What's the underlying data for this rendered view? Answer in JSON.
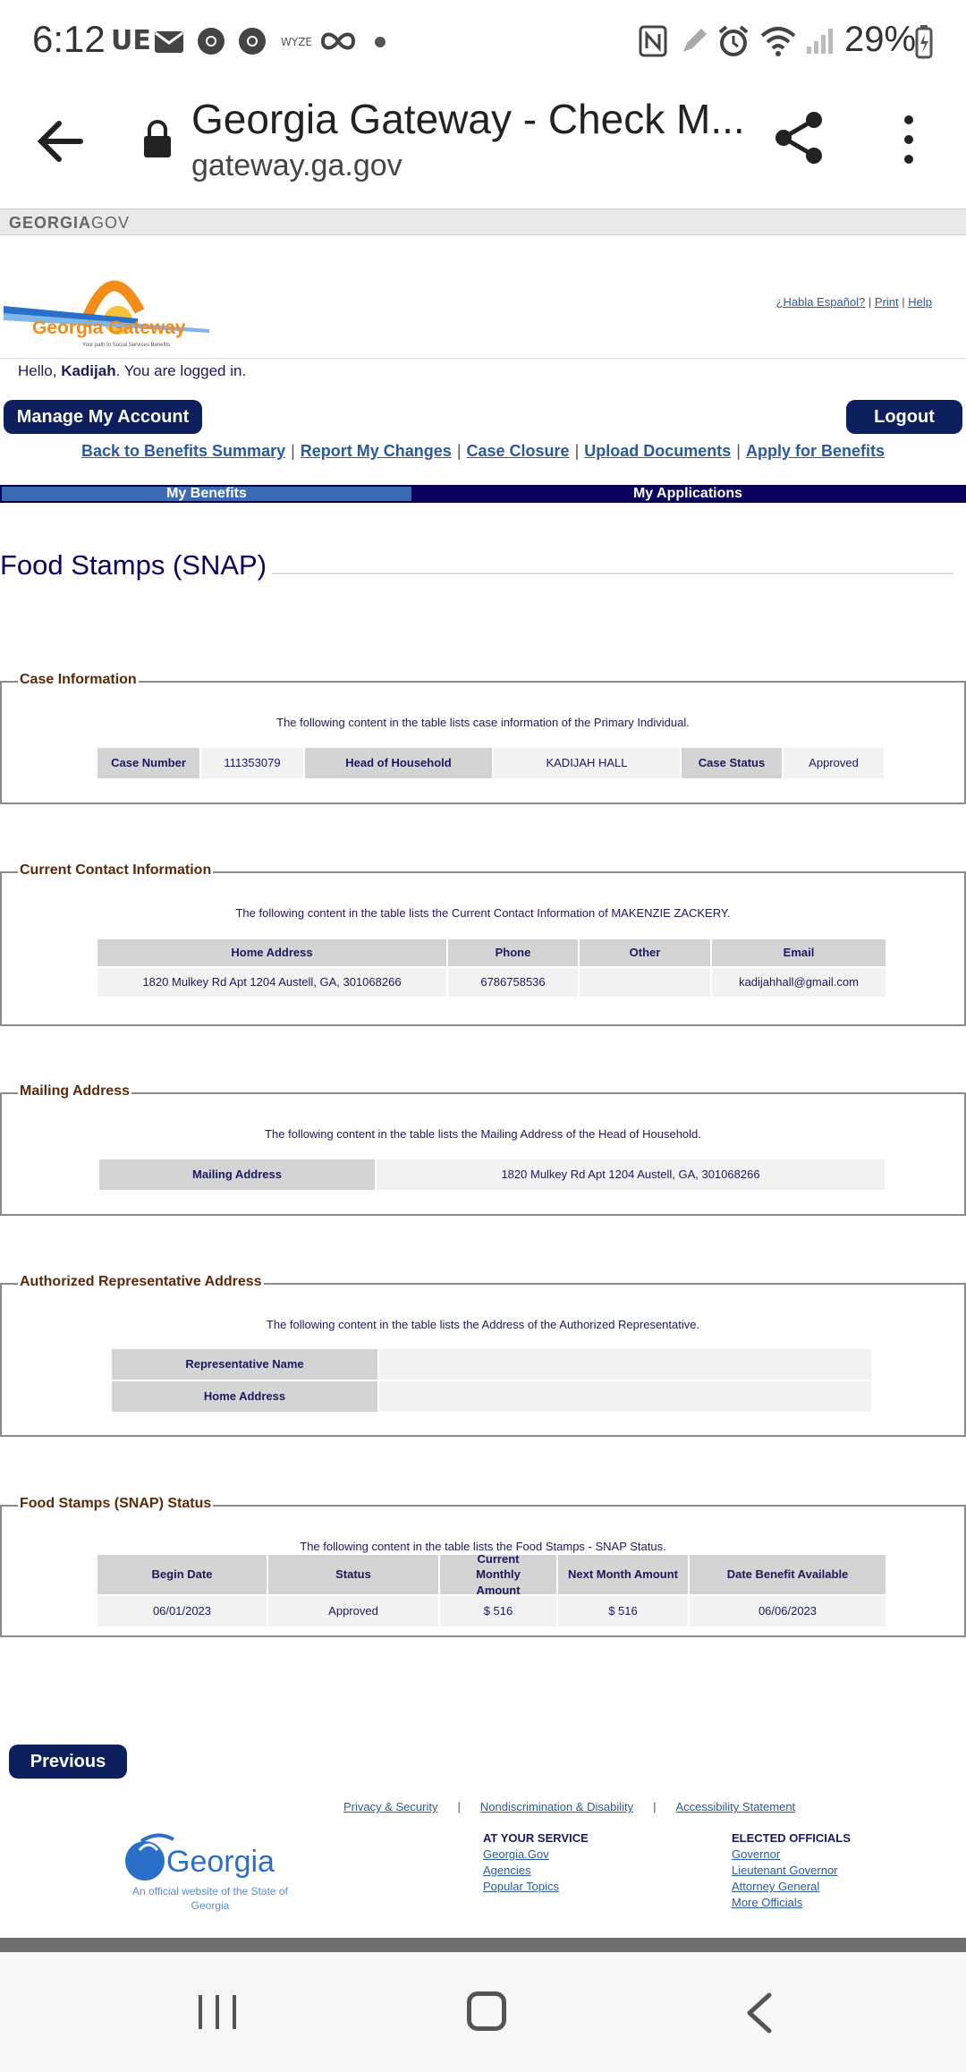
{
  "status_bar": {
    "time": "6:12",
    "left_icons": [
      "UE",
      "mail-icon",
      "chrome-icon",
      "chrome-icon",
      "wyze-icon",
      "infinity-icon",
      "dot-icon"
    ],
    "wyze_label": "WYZE",
    "ue_label": "UE",
    "battery": "29%"
  },
  "browser": {
    "title": "Georgia Gateway - Check M...",
    "url": "gateway.ga.gov"
  },
  "gagov": {
    "label_bold": "GEORGIA",
    "label_rest": "GOV"
  },
  "header": {
    "logo_title": "Georgia Gateway",
    "logo_tagline": "Your path to Social Services Benefits",
    "top_links": [
      "¿Habla Español?",
      "Print",
      "Help"
    ],
    "hello_prefix": "Hello, ",
    "user_name": "Kadijah",
    "hello_suffix": ". You are logged in."
  },
  "buttons": {
    "manage": "Manage My Account",
    "logout": "Logout",
    "previous": "Previous"
  },
  "nav_links": [
    "Back to Benefits Summary",
    "Report My Changes",
    "Case Closure",
    "Upload Documents",
    "Apply for Benefits"
  ],
  "tabs": {
    "benefits": "My Benefits",
    "applications": "My Applications"
  },
  "section_title": "Food Stamps (SNAP)",
  "case_info": {
    "legend": "Case Information",
    "desc": "The following content in the table lists case information of the Primary Individual.",
    "case_number_label": "Case Number",
    "case_number": "111353079",
    "head_label": "Head of Household",
    "head": "KADIJAH HALL",
    "status_label": "Case Status",
    "status": "Approved"
  },
  "contact_info": {
    "legend": "Current Contact Information",
    "desc": "The following content in the table lists the Current Contact Information of MAKENZIE ZACKERY.",
    "headers": [
      "Home Address",
      "Phone",
      "Other",
      "Email"
    ],
    "row": [
      "1820 Mulkey Rd Apt 1204 Austell, GA, 301068266",
      "6786758536",
      "",
      "kadijahhall@gmail.com"
    ]
  },
  "mailing": {
    "legend": "Mailing Address",
    "desc": "The following content in the table lists the Mailing Address of the Head of Household.",
    "label": "Mailing Address",
    "value": "1820 Mulkey Rd Apt 1204 Austell, GA, 301068266"
  },
  "auth_rep": {
    "legend": "Authorized Representative Address",
    "desc": "The following content in the table lists the Address of the Authorized Representative.",
    "name_label": "Representative Name",
    "name": "",
    "address_label": "Home Address",
    "address": ""
  },
  "snap_status": {
    "legend": "Food Stamps (SNAP) Status",
    "desc": "The following content in the table lists the Food Stamps - SNAP Status.",
    "headers": [
      "Begin Date",
      "Status",
      "Current Monthly Amount",
      "Next Month Amount",
      "Date Benefit Available"
    ],
    "row": [
      "06/01/2023",
      "Approved",
      "$ 516",
      "$ 516",
      "06/06/2023"
    ]
  },
  "footer": {
    "links": [
      "Privacy & Security",
      "Nondiscrimination & Disability",
      "Accessibility Statement"
    ],
    "logo_text": "Georgia",
    "logo_sub": "An official website of the State of Georgia",
    "service_heading": "AT YOUR SERVICE",
    "service_links": [
      "Georgia.Gov",
      "Agencies",
      "Popular Topics"
    ],
    "officials_heading": "ELECTED OFFICIALS",
    "officials_links": [
      "Governor",
      "Lieutenant Governor",
      "Attorney General",
      "More Officials"
    ]
  },
  "colors": {
    "navy": "#0d1f5c",
    "tab_active": "#3b6ab5",
    "tab_bar": "#0a005e",
    "legend": "#5a2a0a",
    "link": "#2a5a9a"
  }
}
